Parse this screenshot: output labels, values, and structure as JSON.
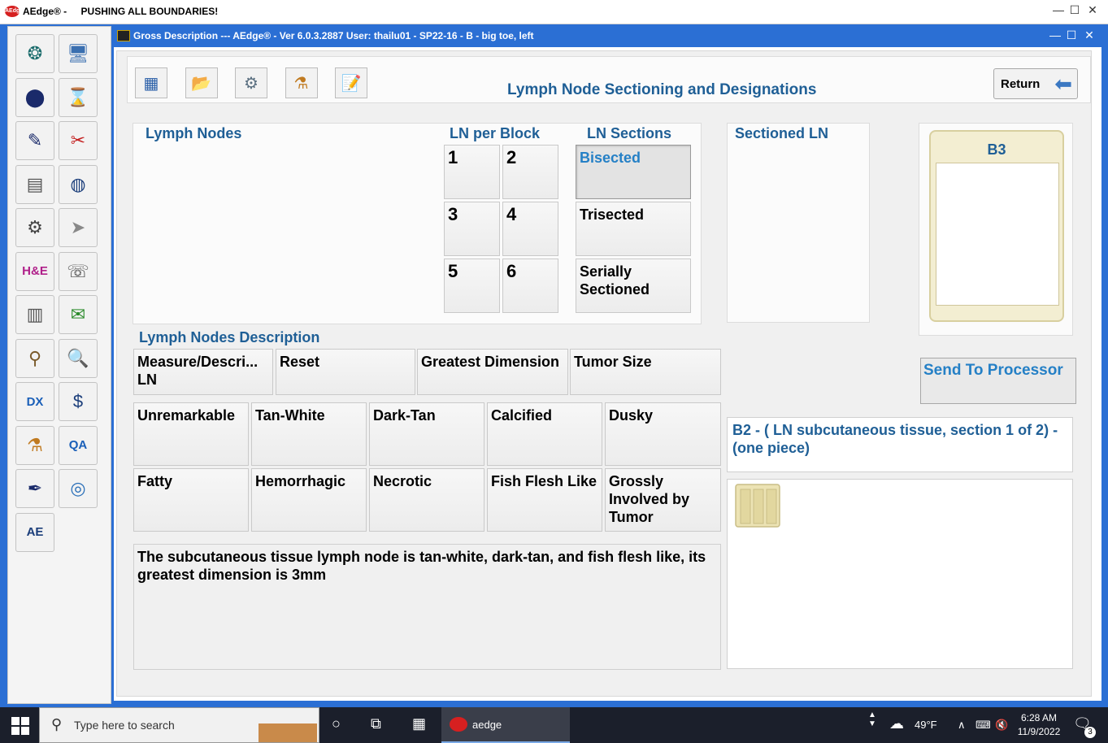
{
  "outer_window": {
    "logo_text": "AEdge",
    "title": "AEdge® -",
    "tagline": "PUSHING ALL BOUNDARIES!"
  },
  "inner_window": {
    "title": "Gross Description --- AEdge® -  Ver 6.0.3.2887  User: thailu01 - SP22-16 - B - big toe, left"
  },
  "left_toolbar": {
    "items": [
      {
        "icon": "network-globe-icon",
        "glyph": "❂",
        "color": "#1a6b6b"
      },
      {
        "icon": "computer-monitor-icon",
        "glyph": "🖥",
        "color": "#3a6fb0"
      },
      {
        "icon": "specimen-jar-icon",
        "glyph": "⬤",
        "color": "#1a2a6a"
      },
      {
        "icon": "hourglass-icon",
        "glyph": "⌛",
        "color": "#5a6f80"
      },
      {
        "icon": "gross-description-icon",
        "glyph": "✎",
        "color": "#1a2a6a"
      },
      {
        "icon": "tools-icon",
        "glyph": "✂",
        "color": "#c42020"
      },
      {
        "icon": "processor-machine-icon",
        "glyph": "▤",
        "color": "#555555"
      },
      {
        "icon": "sphere-icon",
        "glyph": "◍",
        "color": "#1a3d7a"
      },
      {
        "icon": "microtome-icon",
        "glyph": "⚙",
        "color": "#444444"
      },
      {
        "icon": "send-plane-icon",
        "glyph": "➤",
        "color": "#888888"
      },
      {
        "icon": "he-stain-icon",
        "glyph": "H&E",
        "color": "#b0208a"
      },
      {
        "icon": "fax-printer-icon",
        "glyph": "☏",
        "color": "#4a4a4a"
      },
      {
        "icon": "slides-stack-icon",
        "glyph": "▥",
        "color": "#555555"
      },
      {
        "icon": "email-arrow-icon",
        "glyph": "✉",
        "color": "#2a8a2a"
      },
      {
        "icon": "magnifier-icon",
        "glyph": "⚲",
        "color": "#7a5a2a"
      },
      {
        "icon": "document-search-icon",
        "glyph": "🔍",
        "color": "#555555"
      },
      {
        "icon": "dx-icon",
        "glyph": "DX",
        "color": "#1a5fb8"
      },
      {
        "icon": "billing-dollar-icon",
        "glyph": "$",
        "color": "#1a3d7a"
      },
      {
        "icon": "lab-beakers-icon",
        "glyph": "⚗",
        "color": "#c07a20"
      },
      {
        "icon": "qa-icon",
        "glyph": "QA",
        "color": "#1a5fb8"
      },
      {
        "icon": "fountain-pen-icon",
        "glyph": "✒",
        "color": "#1a2a6a"
      },
      {
        "icon": "help-globe-icon",
        "glyph": "◎",
        "color": "#2a6fb8"
      },
      {
        "icon": "aedoc-logo-icon",
        "glyph": "AE",
        "color": "#1a3d7a"
      }
    ]
  },
  "top_toolbar": {
    "buttons": [
      {
        "icon": "grid-menu-icon",
        "glyph": "▦",
        "color": "#2a5fa8"
      },
      {
        "icon": "folder-icon",
        "glyph": "📂",
        "color": "#d4a020"
      },
      {
        "icon": "settings-upload-icon",
        "glyph": "⚙",
        "color": "#5a6f80"
      },
      {
        "icon": "lab-beakers-icon",
        "glyph": "⚗",
        "color": "#c07a20"
      },
      {
        "icon": "notepad-icon",
        "glyph": "📝",
        "color": "#4a4a4a"
      }
    ],
    "page_title": "Lymph Node Sectioning and Designations",
    "return_label": "Return"
  },
  "lymph_nodes": {
    "heading": "Lymph Nodes",
    "ln_per_block_heading": "LN per Block",
    "ln_per_block": [
      "1",
      "2",
      "3",
      "4",
      "5",
      "6"
    ],
    "ln_sections_heading": "LN Sections",
    "ln_sections": [
      "Bisected",
      "Trisected",
      "Serially Sectioned"
    ],
    "selected_section": "Bisected"
  },
  "sectioned_ln": {
    "heading": "Sectioned LN"
  },
  "cassette": {
    "label": "B3"
  },
  "description": {
    "heading": "Lymph Nodes Description",
    "action_buttons": [
      "Measure/Descri... LN",
      "Reset",
      "Greatest Dimension",
      "Tumor Size"
    ],
    "row1": [
      "Unremarkable",
      "Tan-White",
      "Dark-Tan",
      "Calcified",
      "Dusky"
    ],
    "row2": [
      "Fatty",
      "Hemorrhagic",
      "Necrotic",
      "Fish Flesh Like",
      "Grossly Involved by Tumor"
    ],
    "text": "The subcutaneous tissue lymph node is tan-white, dark-tan, and fish flesh like, its greatest dimension is  3mm"
  },
  "send_to_processor": "Send To Processor",
  "block_description": "B2 - ( LN subcutaneous tissue, section 1 of 2) -  (one piece)",
  "taskbar": {
    "search_placeholder": "Type here to search",
    "app_label": "aedge",
    "weather": "49°F",
    "time": "6:28 AM",
    "date": "11/9/2022",
    "notifications": "3"
  }
}
